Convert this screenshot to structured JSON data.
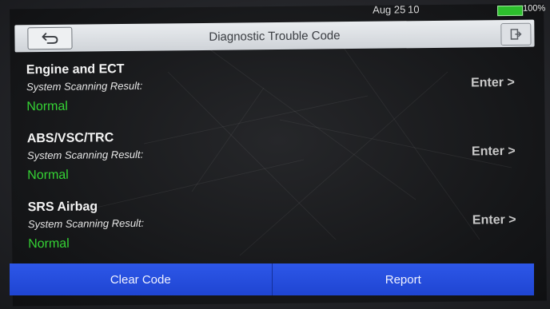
{
  "status": {
    "date": "Aug 25",
    "time": "10",
    "battery": "100%"
  },
  "header": {
    "title": "Diagnostic Trouble Code"
  },
  "systems": [
    {
      "name": "Engine and ECT",
      "label": "System Scanning Result:",
      "result": "Normal",
      "action": "Enter >"
    },
    {
      "name": "ABS/VSC/TRC",
      "label": "System Scanning Result:",
      "result": "Normal",
      "action": "Enter >"
    },
    {
      "name": "SRS Airbag",
      "label": "System Scanning Result:",
      "result": "Normal",
      "action": "Enter >"
    }
  ],
  "footer": {
    "clear_label": "Clear Code",
    "report_label": "Report"
  },
  "colors": {
    "result_ok": "#35d435",
    "button_blue": "#2d57e8",
    "titlebar": "#e9ecef"
  }
}
